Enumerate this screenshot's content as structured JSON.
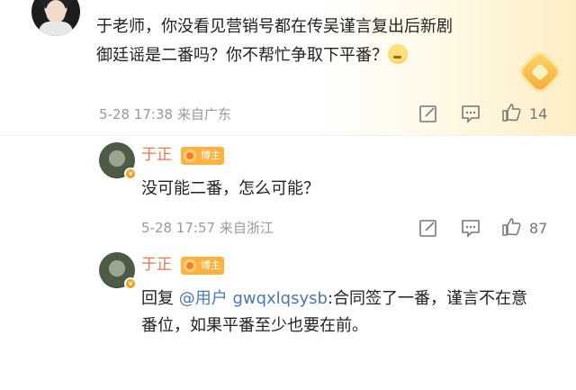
{
  "comment": {
    "text": "于老师，你没看见营销号都在传吴谨言复出后新剧御廷谣是二番吗？你不帮忙争取下平番？",
    "date": "5-28 17:38",
    "source": "来自广东",
    "likes": "14"
  },
  "replies": [
    {
      "name": "于正",
      "badge": "博主",
      "text": "没可能二番，怎么可能？",
      "date": "5-28 17:57",
      "source": "来自浙江",
      "likes": "87"
    },
    {
      "name": "于正",
      "badge": "博主",
      "prefix": "回复",
      "mention": "@用户 gwqxlqsysb",
      "text": ":合同签了一番，谨言不在意番位，如果平番至少也要在前。"
    }
  ],
  "colors": {
    "name": "#eb7350",
    "mention": "#4b77b4",
    "badge": "#ffb23f",
    "meta": "#999999"
  },
  "icons": [
    "edit-icon",
    "comment-icon",
    "like-icon",
    "gem-badge-icon",
    "emoji-icon"
  ]
}
